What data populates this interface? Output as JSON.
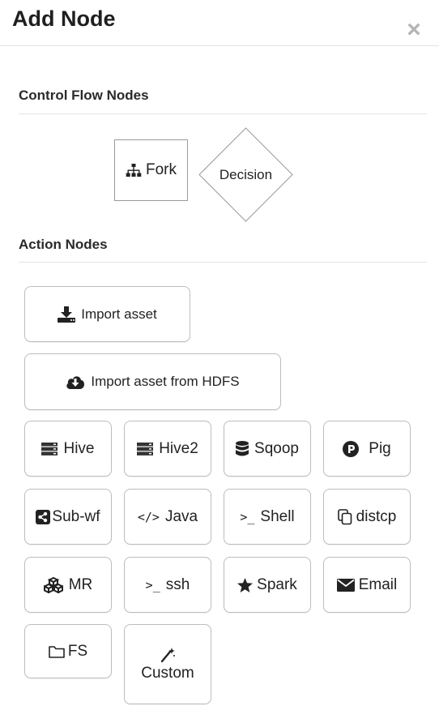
{
  "dialog": {
    "title": "Add Node",
    "close_label": "×"
  },
  "control_flow": {
    "heading": "Control Flow Nodes",
    "fork_label": "Fork",
    "decision_label": "Decision"
  },
  "action_nodes": {
    "heading": "Action Nodes",
    "import_asset": "Import asset",
    "import_hdfs": "Import asset from HDFS",
    "hive": "Hive",
    "hive2": "Hive2",
    "sqoop": "Sqoop",
    "pig": "Pig",
    "subwf": "Sub-wf",
    "java": "Java",
    "shell": "Shell",
    "distcp": "distcp",
    "mr": "MR",
    "ssh": "ssh",
    "spark": "Spark",
    "email": "Email",
    "fs": "FS",
    "custom": "Custom",
    "java_glyph": "</>",
    "shell_glyph": ">_",
    "ssh_glyph": ">_"
  },
  "icons": {
    "fork": "sitemap-icon",
    "import_asset": "download-icon",
    "import_hdfs": "cloud-download-icon",
    "hive": "server-icon",
    "hive2": "server-icon",
    "sqoop": "database-icon",
    "pig": "pig-p-icon",
    "subwf": "share-icon",
    "java": "code-icon",
    "shell": "terminal-icon",
    "distcp": "copy-icon",
    "mr": "cubes-icon",
    "ssh": "terminal-icon",
    "spark": "star-icon",
    "email": "envelope-icon",
    "fs": "folder-icon",
    "custom": "magic-wand-icon"
  },
  "colors": {
    "border": "#bdbdbd",
    "text": "#222222",
    "close": "#b5b5b5"
  }
}
